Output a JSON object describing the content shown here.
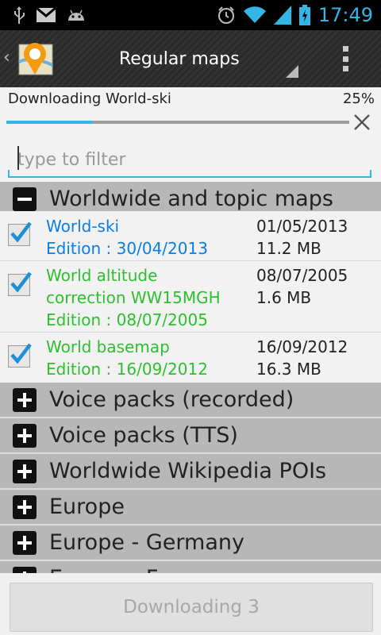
{
  "status_bar": {
    "time": "17:49",
    "left_icons": [
      "usb-icon",
      "gmail-icon",
      "android-icon"
    ],
    "right_icons": [
      "alarm-icon",
      "wifi-icon",
      "signal-icon",
      "battery-icon"
    ],
    "accent": "#33b5e5"
  },
  "action_bar": {
    "title": "Regular maps",
    "logo": "app-logo-icon",
    "overflow": "overflow-menu-icon"
  },
  "download": {
    "label": "Downloading World-ski",
    "percent_text": "25%",
    "progress": 0.25
  },
  "filter": {
    "placeholder": "type to filter",
    "value": ""
  },
  "groups": [
    {
      "title": "Worldwide and topic maps",
      "expanded": true,
      "items": [
        {
          "name": "World-ski",
          "edition": "Edition : 30/04/2013",
          "date": "01/05/2013",
          "size": "11.2 MB",
          "checked": true,
          "color": "#0a7de6"
        },
        {
          "name_line1": "World altitude",
          "name_line2": "correction WW15MGH",
          "edition": "Edition : 08/07/2005",
          "date": "08/07/2005",
          "size": "1.6 MB",
          "checked": true,
          "color": "#2ebf2e"
        },
        {
          "name": "World basemap",
          "edition": "Edition : 16/09/2012",
          "date": "16/09/2012",
          "size": "16.3 MB",
          "checked": true,
          "color": "#2ebf2e"
        }
      ]
    },
    {
      "title": "Voice packs (recorded)",
      "expanded": false
    },
    {
      "title": "Voice packs (TTS)",
      "expanded": false
    },
    {
      "title": "Worldwide Wikipedia POIs",
      "expanded": false
    },
    {
      "title": "Europe",
      "expanded": false
    },
    {
      "title": "Europe - Germany",
      "expanded": false
    },
    {
      "title": "Europe - France",
      "expanded": false
    }
  ],
  "bottom": {
    "button_label": "Downloading 3"
  }
}
